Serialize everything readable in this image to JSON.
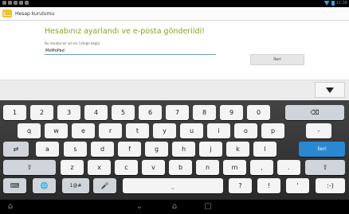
{
  "status_bar": {
    "time": "11:36",
    "icons": [
      "usb-icon",
      "notification-icon",
      "mail-icon",
      "download-icon",
      "lock-icon"
    ]
  },
  "action_bar": {
    "title": "Hesap kurulumu",
    "icon": "mail-setup-icon"
  },
  "content": {
    "heading": "Hesabınız ayarlandı ve e-posta gönderildi!",
    "field_label": "Bu hesaba bir ad ver (isteğe bağlı)",
    "name_value": "MeMoPad",
    "next_button": "İleri"
  },
  "keyboard": {
    "collapse_icon": "collapse-keyboard-icon",
    "rows": [
      [
        "1",
        "2",
        "3",
        "4",
        "5",
        "6",
        "7",
        "8",
        "9",
        "0",
        "⌫"
      ],
      [
        "q",
        "w",
        "e",
        "r",
        "t",
        "y",
        "u",
        "i",
        "o",
        "p",
        "-"
      ],
      [
        "⇄",
        "a",
        "s",
        "d",
        "f",
        "g",
        "h",
        "j",
        "k",
        "l",
        "İleri"
      ],
      [
        "⇧",
        "z",
        "x",
        "c",
        "v",
        "b",
        "n",
        "m",
        ",",
        ".",
        "⇧"
      ],
      [
        "⌨",
        "🌐",
        "1@#",
        "🎤",
        "space",
        "?",
        "!",
        "'",
        ":-)"
      ]
    ]
  },
  "nav_bar": {
    "icons": [
      "back-icon",
      "home-icon",
      "recents-icon",
      "screenshot-icon"
    ]
  },
  "colors": {
    "heading": "#82a81c",
    "accent": "#2a88d0",
    "status": "#2fa7d8",
    "keyboard_bg": "#363636"
  }
}
